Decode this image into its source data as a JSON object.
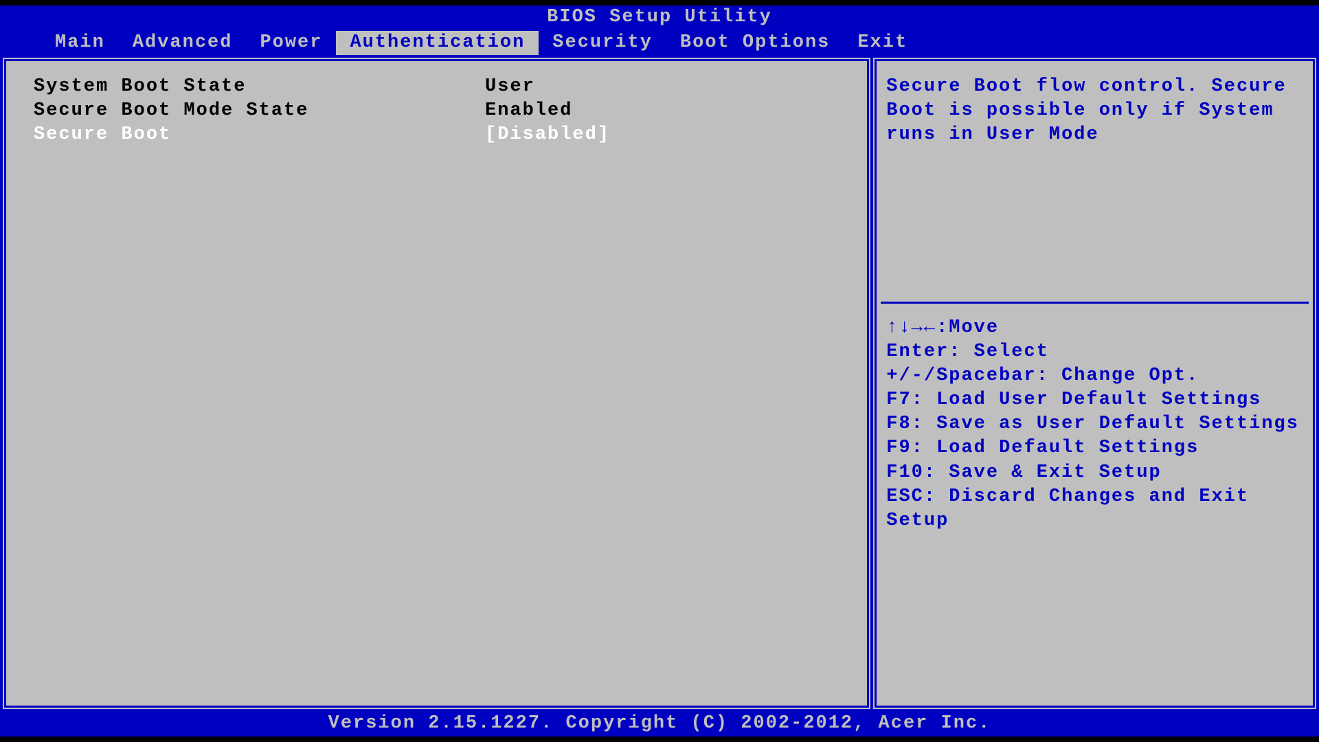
{
  "title": "BIOS Setup Utility",
  "menu": {
    "items": [
      {
        "label": "Main",
        "active": false
      },
      {
        "label": "Advanced",
        "active": false
      },
      {
        "label": "Power",
        "active": false
      },
      {
        "label": "Authentication",
        "active": true
      },
      {
        "label": "Security",
        "active": false
      },
      {
        "label": "Boot Options",
        "active": false
      },
      {
        "label": "Exit",
        "active": false
      }
    ]
  },
  "settings": [
    {
      "label": "System Boot State",
      "value": "User",
      "selected": false,
      "editable": false
    },
    {
      "label": "Secure Boot Mode State",
      "value": "Enabled",
      "selected": false,
      "editable": false
    },
    {
      "label": "Secure Boot",
      "value": "[Disabled]",
      "selected": true,
      "editable": true
    }
  ],
  "help": {
    "text": "Secure Boot flow control. Secure Boot is possible only if System runs in User Mode"
  },
  "keys": {
    "arrows_label": ":Move",
    "hints": [
      "Enter: Select",
      "+/-/Spacebar: Change Opt.",
      "F7: Load User Default Settings",
      "F8: Save as User Default Settings",
      "F9: Load Default Settings",
      "F10: Save & Exit Setup",
      "ESC: Discard Changes and Exit Setup"
    ]
  },
  "footer": "Version 2.15.1227. Copyright (C) 2002-2012, Acer Inc."
}
